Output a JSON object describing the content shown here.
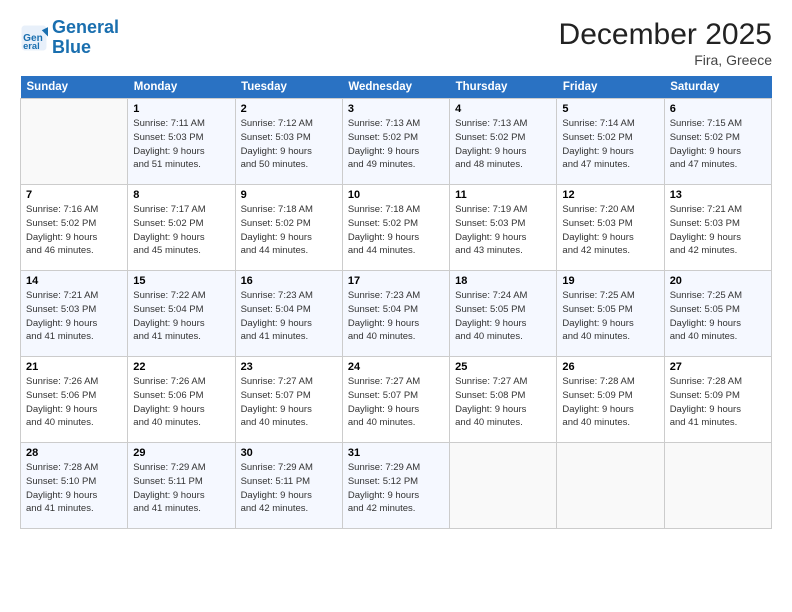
{
  "header": {
    "logo_general": "General",
    "logo_blue": "Blue",
    "month_title": "December 2025",
    "location": "Fira, Greece"
  },
  "days_of_week": [
    "Sunday",
    "Monday",
    "Tuesday",
    "Wednesday",
    "Thursday",
    "Friday",
    "Saturday"
  ],
  "weeks": [
    [
      {
        "day": "",
        "info": ""
      },
      {
        "day": "1",
        "info": "Sunrise: 7:11 AM\nSunset: 5:03 PM\nDaylight: 9 hours\nand 51 minutes."
      },
      {
        "day": "2",
        "info": "Sunrise: 7:12 AM\nSunset: 5:03 PM\nDaylight: 9 hours\nand 50 minutes."
      },
      {
        "day": "3",
        "info": "Sunrise: 7:13 AM\nSunset: 5:02 PM\nDaylight: 9 hours\nand 49 minutes."
      },
      {
        "day": "4",
        "info": "Sunrise: 7:13 AM\nSunset: 5:02 PM\nDaylight: 9 hours\nand 48 minutes."
      },
      {
        "day": "5",
        "info": "Sunrise: 7:14 AM\nSunset: 5:02 PM\nDaylight: 9 hours\nand 47 minutes."
      },
      {
        "day": "6",
        "info": "Sunrise: 7:15 AM\nSunset: 5:02 PM\nDaylight: 9 hours\nand 47 minutes."
      }
    ],
    [
      {
        "day": "7",
        "info": "Sunrise: 7:16 AM\nSunset: 5:02 PM\nDaylight: 9 hours\nand 46 minutes."
      },
      {
        "day": "8",
        "info": "Sunrise: 7:17 AM\nSunset: 5:02 PM\nDaylight: 9 hours\nand 45 minutes."
      },
      {
        "day": "9",
        "info": "Sunrise: 7:18 AM\nSunset: 5:02 PM\nDaylight: 9 hours\nand 44 minutes."
      },
      {
        "day": "10",
        "info": "Sunrise: 7:18 AM\nSunset: 5:02 PM\nDaylight: 9 hours\nand 44 minutes."
      },
      {
        "day": "11",
        "info": "Sunrise: 7:19 AM\nSunset: 5:03 PM\nDaylight: 9 hours\nand 43 minutes."
      },
      {
        "day": "12",
        "info": "Sunrise: 7:20 AM\nSunset: 5:03 PM\nDaylight: 9 hours\nand 42 minutes."
      },
      {
        "day": "13",
        "info": "Sunrise: 7:21 AM\nSunset: 5:03 PM\nDaylight: 9 hours\nand 42 minutes."
      }
    ],
    [
      {
        "day": "14",
        "info": "Sunrise: 7:21 AM\nSunset: 5:03 PM\nDaylight: 9 hours\nand 41 minutes."
      },
      {
        "day": "15",
        "info": "Sunrise: 7:22 AM\nSunset: 5:04 PM\nDaylight: 9 hours\nand 41 minutes."
      },
      {
        "day": "16",
        "info": "Sunrise: 7:23 AM\nSunset: 5:04 PM\nDaylight: 9 hours\nand 41 minutes."
      },
      {
        "day": "17",
        "info": "Sunrise: 7:23 AM\nSunset: 5:04 PM\nDaylight: 9 hours\nand 40 minutes."
      },
      {
        "day": "18",
        "info": "Sunrise: 7:24 AM\nSunset: 5:05 PM\nDaylight: 9 hours\nand 40 minutes."
      },
      {
        "day": "19",
        "info": "Sunrise: 7:25 AM\nSunset: 5:05 PM\nDaylight: 9 hours\nand 40 minutes."
      },
      {
        "day": "20",
        "info": "Sunrise: 7:25 AM\nSunset: 5:05 PM\nDaylight: 9 hours\nand 40 minutes."
      }
    ],
    [
      {
        "day": "21",
        "info": "Sunrise: 7:26 AM\nSunset: 5:06 PM\nDaylight: 9 hours\nand 40 minutes."
      },
      {
        "day": "22",
        "info": "Sunrise: 7:26 AM\nSunset: 5:06 PM\nDaylight: 9 hours\nand 40 minutes."
      },
      {
        "day": "23",
        "info": "Sunrise: 7:27 AM\nSunset: 5:07 PM\nDaylight: 9 hours\nand 40 minutes."
      },
      {
        "day": "24",
        "info": "Sunrise: 7:27 AM\nSunset: 5:07 PM\nDaylight: 9 hours\nand 40 minutes."
      },
      {
        "day": "25",
        "info": "Sunrise: 7:27 AM\nSunset: 5:08 PM\nDaylight: 9 hours\nand 40 minutes."
      },
      {
        "day": "26",
        "info": "Sunrise: 7:28 AM\nSunset: 5:09 PM\nDaylight: 9 hours\nand 40 minutes."
      },
      {
        "day": "27",
        "info": "Sunrise: 7:28 AM\nSunset: 5:09 PM\nDaylight: 9 hours\nand 41 minutes."
      }
    ],
    [
      {
        "day": "28",
        "info": "Sunrise: 7:28 AM\nSunset: 5:10 PM\nDaylight: 9 hours\nand 41 minutes."
      },
      {
        "day": "29",
        "info": "Sunrise: 7:29 AM\nSunset: 5:11 PM\nDaylight: 9 hours\nand 41 minutes."
      },
      {
        "day": "30",
        "info": "Sunrise: 7:29 AM\nSunset: 5:11 PM\nDaylight: 9 hours\nand 42 minutes."
      },
      {
        "day": "31",
        "info": "Sunrise: 7:29 AM\nSunset: 5:12 PM\nDaylight: 9 hours\nand 42 minutes."
      },
      {
        "day": "",
        "info": ""
      },
      {
        "day": "",
        "info": ""
      },
      {
        "day": "",
        "info": ""
      }
    ]
  ]
}
